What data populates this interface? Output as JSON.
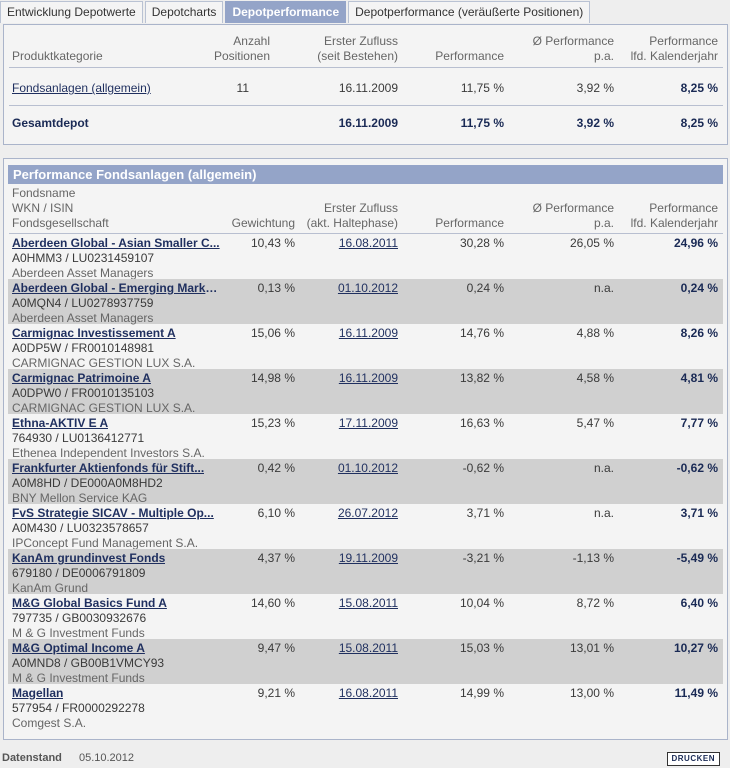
{
  "tabs": [
    {
      "label": "Entwicklung Depotwerte",
      "active": false
    },
    {
      "label": "Depotcharts",
      "active": false
    },
    {
      "label": "Depotperformance",
      "active": true
    },
    {
      "label": "Depotperformance (veräußerte Positionen)",
      "active": false
    }
  ],
  "summary": {
    "headers": {
      "kategorie": "Produktkategorie",
      "anzahl1": "Anzahl",
      "anzahl2": "Positionen",
      "zufluss1": "Erster Zufluss",
      "zufluss2": "(seit Bestehen)",
      "performance": "Performance",
      "pa1": "Ø Performance",
      "pa2": "p.a.",
      "jahr1": "Performance",
      "jahr2": "lfd. Kalenderjahr"
    },
    "rows": [
      {
        "kategorie": "Fondsanlagen (allgemein)",
        "anzahl": "11",
        "zufluss": "16.11.2009",
        "performance": "11,75 %",
        "pa": "3,92 %",
        "jahr": "8,25 %"
      }
    ],
    "total": {
      "kategorie": "Gesamtdepot",
      "zufluss": "16.11.2009",
      "performance": "11,75 %",
      "pa": "3,92 %",
      "jahr": "8,25 %"
    }
  },
  "funds_section": {
    "title": "Performance Fondsanlagen (allgemein)",
    "headers": {
      "name1": "Fondsname",
      "name2": "WKN / ISIN",
      "name3": "Fondsgesellschaft",
      "gewichtung": "Gewichtung",
      "zufluss1": "Erster Zufluss",
      "zufluss2": "(akt. Haltephase)",
      "performance": "Performance",
      "pa1": "Ø Performance",
      "pa2": "p.a.",
      "jahr1": "Performance",
      "jahr2": "lfd. Kalenderjahr"
    },
    "rows": [
      {
        "name": "Aberdeen Global - Asian Smaller C...",
        "wkn": "A0HMM3 /  LU0231459107",
        "kag": "Aberdeen Asset Managers",
        "gew": "10,43 %",
        "zufluss": "16.08.2011",
        "perf": "30,28 %",
        "pa": "26,05 %",
        "jahr": "24,96 %"
      },
      {
        "name": "Aberdeen Global - Emerging Market...",
        "wkn": "A0MQN4 /  LU0278937759",
        "kag": "Aberdeen Asset Managers",
        "gew": "0,13 %",
        "zufluss": "01.10.2012",
        "perf": "0,24 %",
        "pa": "n.a.",
        "jahr": "0,24 %"
      },
      {
        "name": "Carmignac Investissement A",
        "wkn": "A0DP5W /  FR0010148981",
        "kag": "CARMIGNAC GESTION LUX S.A.",
        "gew": "15,06 %",
        "zufluss": "16.11.2009",
        "perf": "14,76 %",
        "pa": "4,88 %",
        "jahr": "8,26 %"
      },
      {
        "name": "Carmignac Patrimoine A",
        "wkn": "A0DPW0 /  FR0010135103",
        "kag": "CARMIGNAC GESTION LUX S.A.",
        "gew": "14,98 %",
        "zufluss": "16.11.2009",
        "perf": "13,82 %",
        "pa": "4,58 %",
        "jahr": "4,81 %"
      },
      {
        "name": "Ethna-AKTIV E A",
        "wkn": "764930 /  LU0136412771",
        "kag": "Ethenea Independent Investors S.A.",
        "gew": "15,23 %",
        "zufluss": "17.11.2009",
        "perf": "16,63 %",
        "pa": "5,47 %",
        "jahr": "7,77 %"
      },
      {
        "name": "Frankfurter Aktienfonds für Stift...",
        "wkn": "A0M8HD /  DE000A0M8HD2",
        "kag": "BNY Mellon Service KAG",
        "gew": "0,42 %",
        "zufluss": "01.10.2012",
        "perf": "-0,62 %",
        "pa": "n.a.",
        "jahr": "-0,62 %"
      },
      {
        "name": "FvS Strategie SICAV - Multiple Op...",
        "wkn": "A0M430 /  LU0323578657",
        "kag": "IPConcept Fund Management S.A.",
        "gew": "6,10 %",
        "zufluss": "26.07.2012",
        "perf": "3,71 %",
        "pa": "n.a.",
        "jahr": "3,71 %"
      },
      {
        "name": "KanAm grundinvest Fonds",
        "wkn": "679180 /  DE0006791809",
        "kag": "KanAm Grund",
        "gew": "4,37 %",
        "zufluss": "19.11.2009",
        "perf": "-3,21 %",
        "pa": "-1,13 %",
        "jahr": "-5,49 %"
      },
      {
        "name": "M&G Global Basics Fund A",
        "wkn": "797735 /  GB0030932676",
        "kag": "M & G Investment Funds",
        "gew": "14,60 %",
        "zufluss": "15.08.2011",
        "perf": "10,04 %",
        "pa": "8,72 %",
        "jahr": "6,40 %"
      },
      {
        "name": "M&G Optimal Income A",
        "wkn": "A0MND8 /  GB00B1VMCY93",
        "kag": "M & G Investment Funds",
        "gew": "9,47 %",
        "zufluss": "15.08.2011",
        "perf": "15,03 %",
        "pa": "13,01 %",
        "jahr": "10,27 %"
      },
      {
        "name": "Magellan",
        "wkn": "577954 /  FR0000292278",
        "kag": "Comgest S.A.",
        "gew": "9,21 %",
        "zufluss": "16.08.2011",
        "perf": "14,99 %",
        "pa": "13,00 %",
        "jahr": "11,49 %"
      }
    ]
  },
  "footer": {
    "label": "Datenstand",
    "date": "05.10.2012",
    "print_button": "DRUCKEN"
  }
}
